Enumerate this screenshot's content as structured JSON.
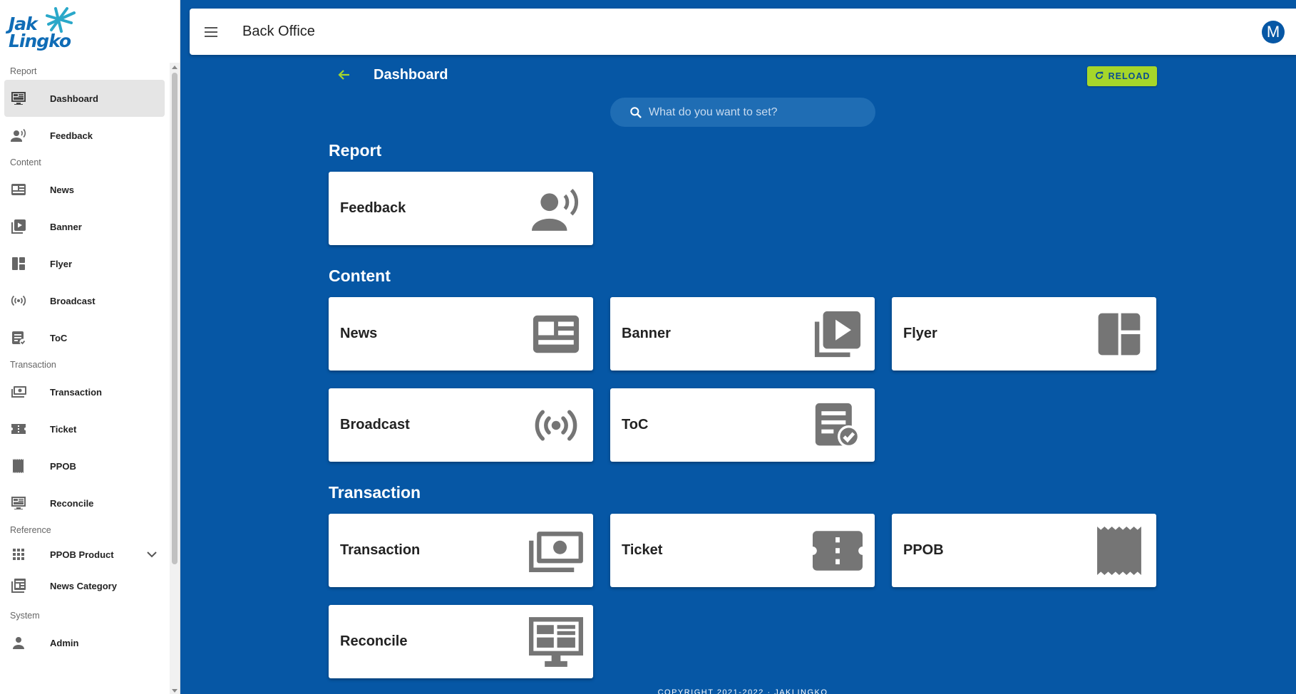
{
  "brand": {
    "logo_text_1": "Jak",
    "logo_text_2": "Lingko"
  },
  "topbar": {
    "title": "Back Office",
    "avatar_initial": "M"
  },
  "sidebar": {
    "groups": [
      {
        "section": "Report",
        "items": [
          {
            "label": "Dashboard",
            "icon": "monitor-dashboard-icon",
            "active": true
          },
          {
            "label": "Feedback",
            "icon": "feedback-voice-icon"
          }
        ]
      },
      {
        "section": "Content",
        "items": [
          {
            "label": "News",
            "icon": "newspaper-icon"
          },
          {
            "label": "Banner",
            "icon": "video-library-icon"
          },
          {
            "label": "Flyer",
            "icon": "dashboard-layout-icon"
          },
          {
            "label": "Broadcast",
            "icon": "broadcast-icon"
          },
          {
            "label": "ToC",
            "icon": "document-check-icon"
          }
        ]
      },
      {
        "section": "Transaction",
        "items": [
          {
            "label": "Transaction",
            "icon": "money-icon"
          },
          {
            "label": "Ticket",
            "icon": "ticket-icon"
          },
          {
            "label": "PPOB",
            "icon": "receipt-icon"
          },
          {
            "label": "Reconcile",
            "icon": "monitor-icon"
          }
        ]
      },
      {
        "section": "Reference",
        "items": [
          {
            "label": "PPOB Product",
            "icon": "grid-icon",
            "expandable": true
          },
          {
            "label": "News Category",
            "icon": "news-list-icon"
          }
        ]
      },
      {
        "section": "System",
        "items": [
          {
            "label": "Admin",
            "icon": "person-icon"
          }
        ]
      }
    ]
  },
  "page": {
    "title": "Dashboard",
    "reload_label": "RELOAD",
    "search_placeholder": "What do you want to set?"
  },
  "categories": [
    {
      "title": "Report",
      "cards": [
        {
          "label": "Feedback",
          "icon": "feedback-voice-icon"
        }
      ]
    },
    {
      "title": "Content",
      "cards": [
        {
          "label": "News",
          "icon": "newspaper-icon"
        },
        {
          "label": "Banner",
          "icon": "video-library-icon"
        },
        {
          "label": "Flyer",
          "icon": "dashboard-layout-icon"
        },
        {
          "label": "Broadcast",
          "icon": "broadcast-icon"
        },
        {
          "label": "ToC",
          "icon": "document-check-icon"
        }
      ]
    },
    {
      "title": "Transaction",
      "cards": [
        {
          "label": "Transaction",
          "icon": "money-icon"
        },
        {
          "label": "Ticket",
          "icon": "ticket-icon"
        },
        {
          "label": "PPOB",
          "icon": "receipt-icon"
        },
        {
          "label": "Reconcile",
          "icon": "monitor-icon"
        }
      ]
    }
  ],
  "footer": {
    "text": "COPYRIGHT 2021-2022 · JAKLINGKO"
  },
  "colors": {
    "background": "#0657a5",
    "accent": "#a6d62a",
    "icon_gray": "#757575"
  }
}
